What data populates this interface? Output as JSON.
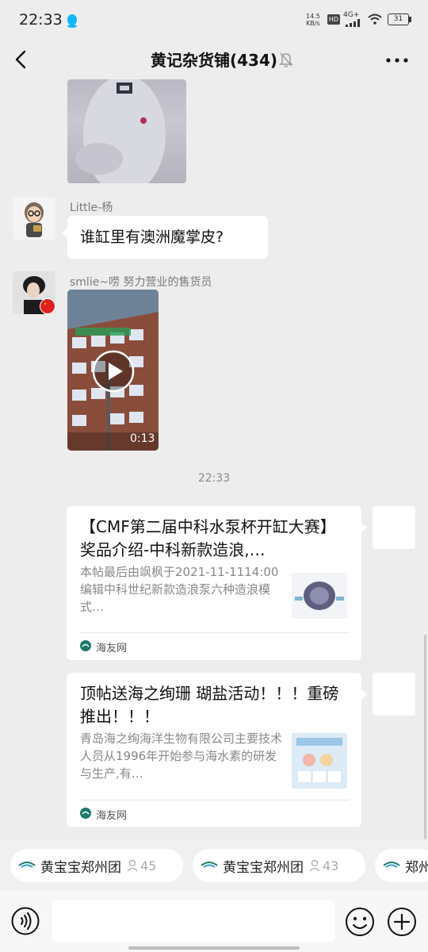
{
  "status_bar": {
    "time": "22:33",
    "net_speed_value": "14.5",
    "net_speed_unit": "KB/s",
    "hd_label": "HD",
    "network_type": "4G+",
    "battery_level": "31"
  },
  "nav": {
    "title": "黄记杂货铺(434)"
  },
  "messages": [
    {
      "type": "image",
      "icon": "snow-photo"
    },
    {
      "type": "text",
      "sender": "Little-杨",
      "text": "谁缸里有澳洲魔掌皮?"
    },
    {
      "type": "video",
      "sender": "smlie~唠 努力营业的售货员",
      "duration": "0:13"
    }
  ],
  "timestamp": "22:33",
  "cards": [
    {
      "title": "【CMF第二届中科水泵杯开缸大赛】奖品介绍-中科新款造浪,…",
      "desc": "本帖最后由飒枫于2021-11-1114:00编辑中科世纪新款造浪泵六种造浪模式…",
      "source": "海友网"
    },
    {
      "title": "顶帖送海之绚珊 瑚盐活动！！！重磅推出！！！",
      "desc": "青岛海之绚海洋生物有限公司主要技术人员从1996年开始参与海水素的研发与生产,有…",
      "source": "海友网"
    }
  ],
  "chips": [
    {
      "label": "黄宝宝郑州团",
      "count": "45"
    },
    {
      "label": "黄宝宝郑州团",
      "count": "43"
    },
    {
      "label": "郑州",
      "count": ""
    }
  ],
  "input": {
    "placeholder": ""
  },
  "colors": {
    "background": "#ededed",
    "bubble": "#ffffff",
    "accent_source": "#1f7a6c"
  }
}
